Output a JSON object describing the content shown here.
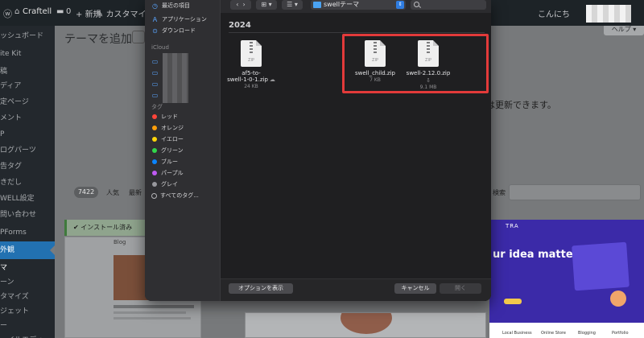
{
  "admin_bar": {
    "site_name": "Craftell",
    "comments_count": "0",
    "new_label": "新規",
    "customize_label": "カスタマイズ",
    "greeting": "こんにち"
  },
  "sidebar": {
    "items": [
      {
        "label": "ッシュボード",
        "active": false
      },
      {
        "label": "ite Kit",
        "active": false
      },
      {
        "label": "稿",
        "active": false
      },
      {
        "label": "ディア",
        "active": false
      },
      {
        "label": "定ページ",
        "active": false
      },
      {
        "label": "メント",
        "active": false
      },
      {
        "label": "P",
        "active": false
      },
      {
        "label": "ログパーツ",
        "active": false
      },
      {
        "label": "告タグ",
        "active": false
      },
      {
        "label": "きだし",
        "active": false
      },
      {
        "label": "WELL設定",
        "active": false
      },
      {
        "label": "問い合わせ",
        "active": false
      },
      {
        "label": "PForms",
        "active": false
      },
      {
        "label": "外観",
        "active": true
      },
      {
        "label": "マ",
        "active": false
      },
      {
        "label": "ーン",
        "active": false
      },
      {
        "label": "タマイズ",
        "active": false
      },
      {
        "label": "ジェット",
        "active": false
      },
      {
        "label": "ー",
        "active": false
      },
      {
        "label": "ァイルエディ",
        "active": false
      }
    ]
  },
  "wp_main": {
    "page_title": "テーマを追加",
    "help_label": "ヘルプ ▾",
    "info_text": "は更新できます。",
    "count_badge": "7422",
    "filter_popular": "人気",
    "filter_latest": "最新",
    "search_label": "検索",
    "installed_label": "インストール済み",
    "card_blog_label": "Blog",
    "purple_card_title": "ur idea matters",
    "purple_card_brand": "TRA",
    "purple_card_footer_a": "Local Business",
    "purple_card_footer_b": "Online Store",
    "purple_card_footer_c": "Blogging",
    "purple_card_footer_d": "Portfolio"
  },
  "dialog": {
    "toolbar": {
      "back_glyph": "‹",
      "forward_glyph": "›",
      "path_folder": "swellテーマ",
      "search_placeholder": ""
    },
    "sidebar": {
      "recents_label": "最近の項目",
      "applications_label": "アプリケーション",
      "downloads_label": "ダウンロード",
      "icloud_label": "iCloud",
      "tags_label": "タグ",
      "tags": [
        {
          "label": "レッド",
          "color": "#ff453a"
        },
        {
          "label": "オレンジ",
          "color": "#ff9f0a"
        },
        {
          "label": "イエロー",
          "color": "#ffd60a"
        },
        {
          "label": "グリーン",
          "color": "#32d74b"
        },
        {
          "label": "ブルー",
          "color": "#0a84ff"
        },
        {
          "label": "パープル",
          "color": "#bf5af2"
        },
        {
          "label": "グレイ",
          "color": "#98989d"
        }
      ],
      "all_tags_label": "すべてのタグ..."
    },
    "year_header": "2024",
    "files": [
      {
        "name_line1": "af5-to-",
        "name_line2": "swell-1-0-1.zip",
        "size": "24 KB",
        "tag": "ZIP",
        "highlighted": false
      },
      {
        "name_line1": "swell_child.zip",
        "name_line2": "",
        "size": "7 KB",
        "tag": "ZIP",
        "highlighted": true
      },
      {
        "name_line1": "swell-2.12.0.zip",
        "name_line2": "",
        "size": "9.1 MB",
        "tag": "ZIP",
        "highlighted": true
      }
    ],
    "footer": {
      "options_label": "オプションを表示",
      "cancel_label": "キャンセル",
      "open_label": "開く"
    }
  },
  "colors": {
    "highlight": "#e23a3a",
    "accent_blue": "#2f7de1",
    "wp_active": "#2271b1"
  }
}
